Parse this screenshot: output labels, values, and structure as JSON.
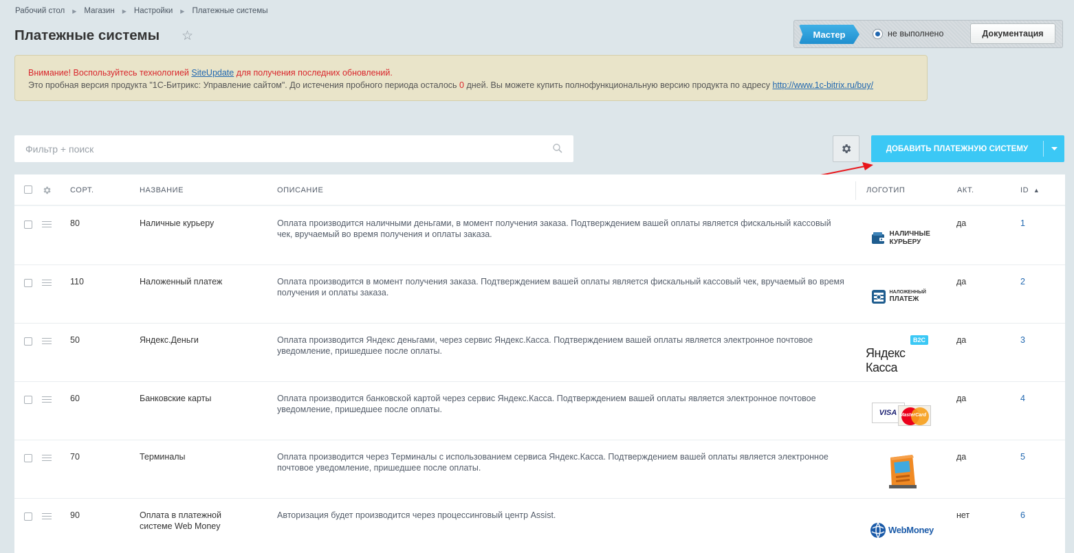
{
  "breadcrumb": [
    "Рабочий стол",
    "Магазин",
    "Настройки",
    "Платежные системы"
  ],
  "page_title": "Платежные системы",
  "master": {
    "button": "Мастер",
    "status": "не выполнено",
    "docs": "Документация"
  },
  "notice": {
    "warn_prefix": "Внимание! Воспользуйтесь технологией ",
    "warn_link": "SiteUpdate",
    "warn_suffix": " для получения последних обновлений.",
    "trial_prefix": "Это пробная версия продукта \"1С-Битрикс: Управление сайтом\". До истечения пробного периода осталось ",
    "trial_days": "0",
    "trial_suffix": " дней. Вы можете купить полнофункциональную версию продукта по адресу ",
    "trial_link": "http://www.1c-bitrix.ru/buy/"
  },
  "filter": {
    "placeholder": "Фильтр + поиск"
  },
  "add_button": "ДОБАВИТЬ ПЛАТЕЖНУЮ СИСТЕМУ",
  "columns": {
    "sort": "СОРТ.",
    "name": "НАЗВАНИЕ",
    "description": "ОПИСАНИЕ",
    "logo": "ЛОГОТИП",
    "active": "АКТ.",
    "id": "ID"
  },
  "rows": [
    {
      "sort": "80",
      "name": "Наличные курьеру",
      "description": "Оплата производится наличными деньгами, в момент получения заказа. Подтверждением вашей оплаты является фискальный кассовый чек, вручаемый во время получения и оплаты заказа.",
      "logo": "cash-courier-logo",
      "logo_text": "НАЛИЧНЫЕ КУРЬЕРУ",
      "active": "да",
      "id": "1"
    },
    {
      "sort": "110",
      "name": "Наложенный платеж",
      "description": "Оплата производится в момент получения заказа. Подтверждением вашей оплаты является фискальный кассовый чек, вручаемый во время получения и оплаты заказа.",
      "logo": "cash-on-delivery-logo",
      "logo_text_small": "НАЛОЖЕННЫЙ",
      "logo_text": "ПЛАТЕЖ",
      "active": "да",
      "id": "2"
    },
    {
      "sort": "50",
      "name": "Яндекс.Деньги",
      "description": "Оплата производится Яндекс деньгами, через сервис Яндекс.Касса. Подтверждением вашей оплаты является электронное почтовое уведомление, пришедшее после оплаты.",
      "logo": "yandex-kassa-logo",
      "logo_text": "Яндекс Касса",
      "logo_badge": "B2C",
      "active": "да",
      "id": "3"
    },
    {
      "sort": "60",
      "name": "Банковские карты",
      "description": "Оплата производится банковской картой через сервис Яндекс.Касса. Подтверждением вашей оплаты является электронное почтовое уведомление, пришедшее после оплаты.",
      "logo": "visa-mastercard-logo",
      "logo_visa": "VISA",
      "logo_mc": "MasterCard",
      "active": "да",
      "id": "4"
    },
    {
      "sort": "70",
      "name": "Терминалы",
      "description": "Оплата производится через Терминалы с использованием сервиса Яндекс.Касса. Подтверждением вашей оплаты является электронное почтовое уведомление, пришедшее после оплаты.",
      "logo": "terminal-logo",
      "active": "да",
      "id": "5"
    },
    {
      "sort": "90",
      "name": "Оплата в платежной системе Web Money",
      "description": "Авторизация будет производится через процессинговый центр Assist.",
      "logo": "webmoney-logo",
      "logo_text": "WebMoney",
      "active": "нет",
      "id": "6"
    }
  ],
  "colors": {
    "accent": "#3bc8f5",
    "link": "#2067b0",
    "warning": "#d9262c",
    "arrow": "#e8161b"
  }
}
